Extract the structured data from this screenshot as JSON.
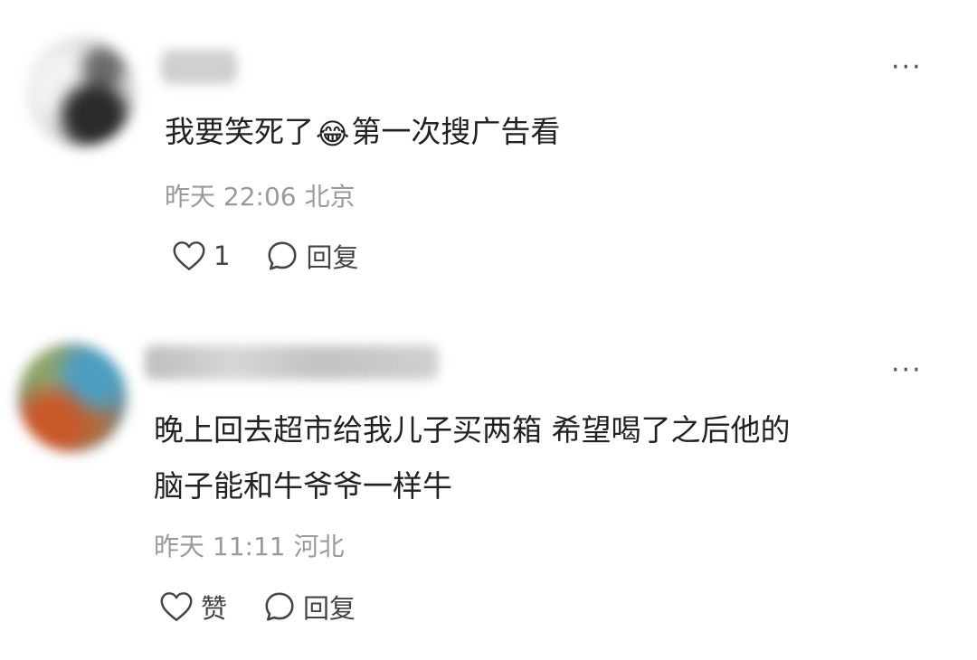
{
  "comments": [
    {
      "more_icon": "more-dots-icon",
      "text_before": "我要笑死了",
      "emoji": "😂",
      "text_after": "第一次搜广告看",
      "meta": "昨天 22:06 北京",
      "like_label": "1",
      "reply_label": "回复"
    },
    {
      "more_icon": "more-dots-icon",
      "text_line1": "晚上回去超市给我儿子买两箱 希望喝了之后他的",
      "text_line2": "脑子能和牛爷爷一样牛",
      "meta": "昨天 11:11 河北",
      "like_label": "赞",
      "reply_label": "回复"
    }
  ],
  "colors": {
    "text": "#222222",
    "meta": "#9a9a9a",
    "icon": "#444444"
  }
}
